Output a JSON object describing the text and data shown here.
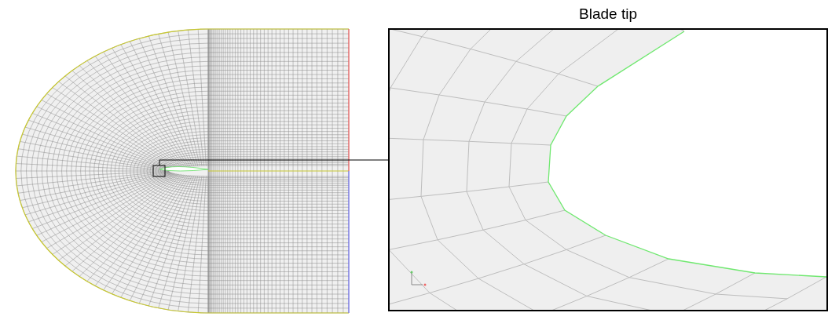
{
  "inset": {
    "title": "Blade tip"
  }
}
